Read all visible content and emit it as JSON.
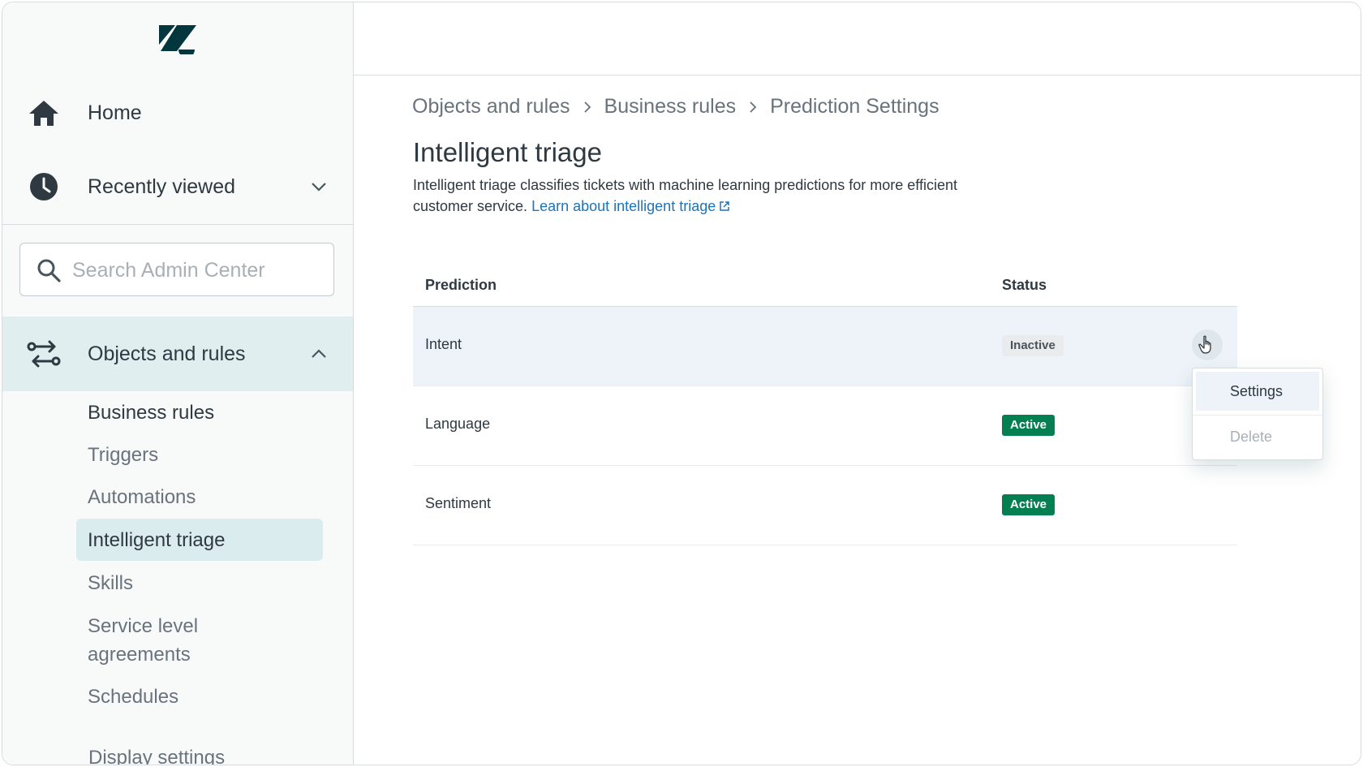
{
  "sidebar": {
    "home_label": "Home",
    "recent_label": "Recently viewed",
    "search_placeholder": "Search Admin Center",
    "objects_label": "Objects and rules",
    "sub_items": {
      "business_rules": "Business rules",
      "triggers": "Triggers",
      "automations": "Automations",
      "intelligent_triage": "Intelligent triage",
      "skills": "Skills",
      "sla_line1": "Service level",
      "sla_line2": "agreements",
      "schedules": "Schedules",
      "display_settings": "Display settings"
    }
  },
  "breadcrumb": {
    "item1": "Objects and rules",
    "item2": "Business rules",
    "item3": "Prediction Settings"
  },
  "page": {
    "title": "Intelligent triage",
    "description": "Intelligent triage classifies tickets with machine learning predictions for more efficient customer service.",
    "learn_link": "Learn about intelligent triage"
  },
  "table": {
    "col_prediction": "Prediction",
    "col_status": "Status",
    "rows": [
      {
        "name": "Intent",
        "status": "Inactive"
      },
      {
        "name": "Language",
        "status": "Active"
      },
      {
        "name": "Sentiment",
        "status": "Active"
      }
    ]
  },
  "menu": {
    "settings": "Settings",
    "delete": "Delete"
  },
  "colors": {
    "accent": "#1f73b7",
    "active_badge": "#037f52",
    "selected_nav": "#dbecee"
  }
}
